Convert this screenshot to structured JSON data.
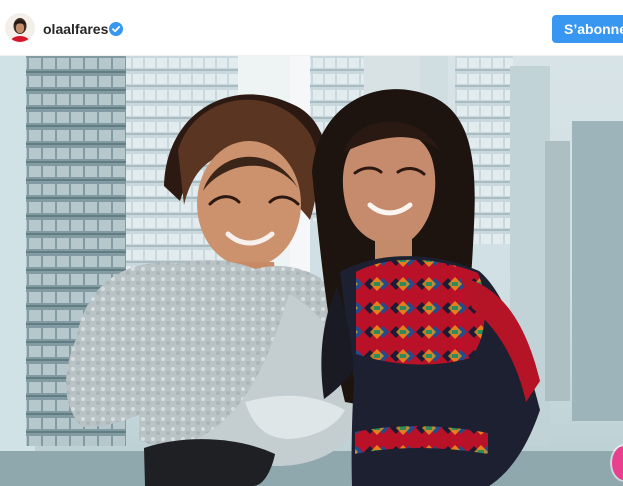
{
  "post": {
    "username": "olaalfares",
    "follow_label": "S’abonner",
    "verified": true
  },
  "icons": {
    "avatar": "profile-avatar",
    "verified_badge": "verified-check-icon"
  },
  "colors": {
    "follow_button": "#3897f0",
    "verified_badge": "#3897f0",
    "side_button": "#e83f8f"
  }
}
